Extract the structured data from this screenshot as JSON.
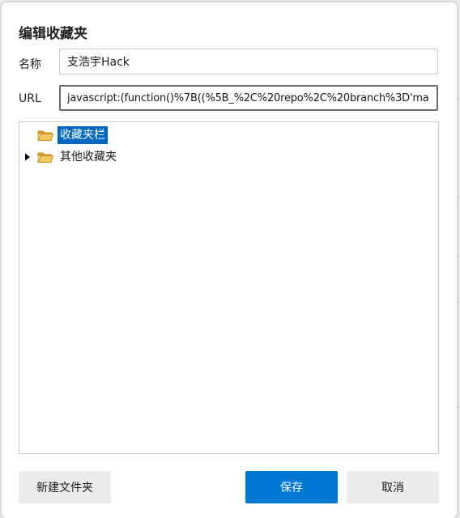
{
  "dialog": {
    "title": "编辑收藏夹",
    "name_field": {
      "label": "名称",
      "value": "支浩宇Hack"
    },
    "url_field": {
      "label": "URL",
      "value": "javascript:(function()%7B((%5B_%2C%20repo%2C%20branch%3D'ma"
    },
    "folder_tree": {
      "items": [
        {
          "label": "收藏夹栏",
          "selected": true,
          "expandable": false,
          "icon": "folder-open-icon"
        },
        {
          "label": "其他收藏夹",
          "selected": false,
          "expandable": true,
          "icon": "folder-icon"
        }
      ]
    },
    "buttons": {
      "new_folder": "新建文件夹",
      "save": "保存",
      "cancel": "取消"
    }
  },
  "colors": {
    "accent": "#0078d4",
    "selection": "#0067c0",
    "folder": "#e8b64a"
  }
}
